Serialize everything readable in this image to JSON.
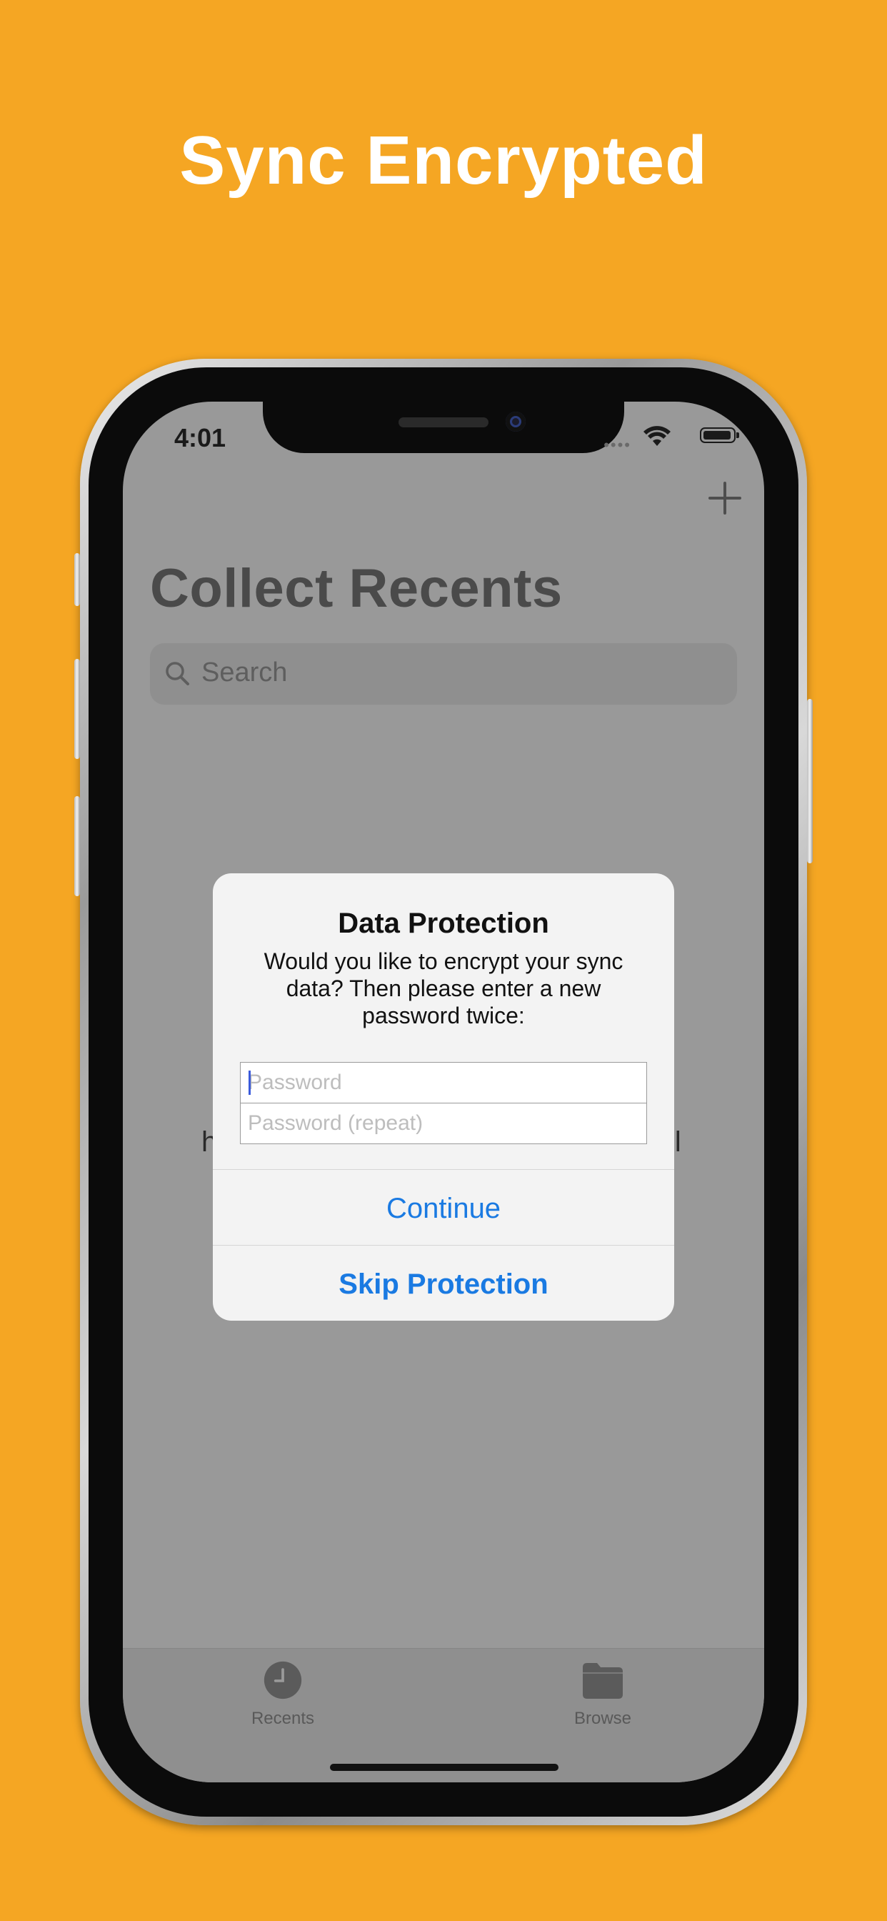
{
  "headline": "Sync Encrypted",
  "colors": {
    "background": "#F5A623",
    "accent": "#1a7ae2"
  },
  "status_bar": {
    "time": "4:01"
  },
  "app": {
    "title": "Collect Recents",
    "add_icon": "plus-icon",
    "search": {
      "placeholder": "Search"
    },
    "background_text": {
      "left": "h",
      "right": "ll"
    }
  },
  "alert": {
    "title": "Data Protection",
    "message": "Would you like to encrypt your sync data? Then please enter a new password twice:",
    "password_placeholder": "Password",
    "password_repeat_placeholder": "Password (repeat)",
    "continue_label": "Continue",
    "skip_label": "Skip Protection"
  },
  "tabbar": {
    "items": [
      {
        "label": "Recents",
        "icon": "clock-icon"
      },
      {
        "label": "Browse",
        "icon": "folder-icon"
      }
    ]
  }
}
